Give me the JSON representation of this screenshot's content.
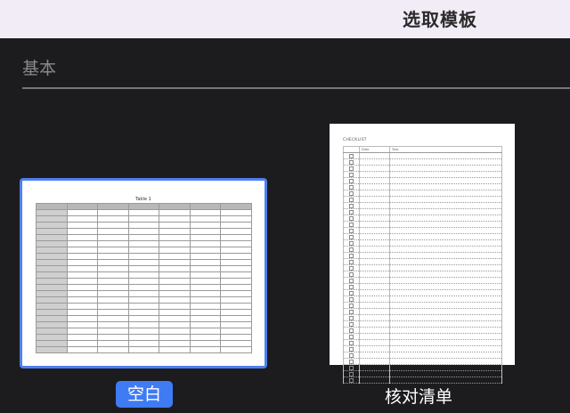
{
  "header": {
    "title": "选取模板"
  },
  "section": {
    "label": "基本"
  },
  "templates": {
    "blank": {
      "label": "空白",
      "preview_title": "Table 1"
    },
    "checklist": {
      "label": "核对清单",
      "preview_title": "CHECKLIST",
      "columns": [
        "",
        "Date",
        "Task"
      ]
    }
  },
  "colors": {
    "accent": "#3f7bf2",
    "background": "#1c1c1e",
    "header_bg": "#f1ecf6"
  }
}
